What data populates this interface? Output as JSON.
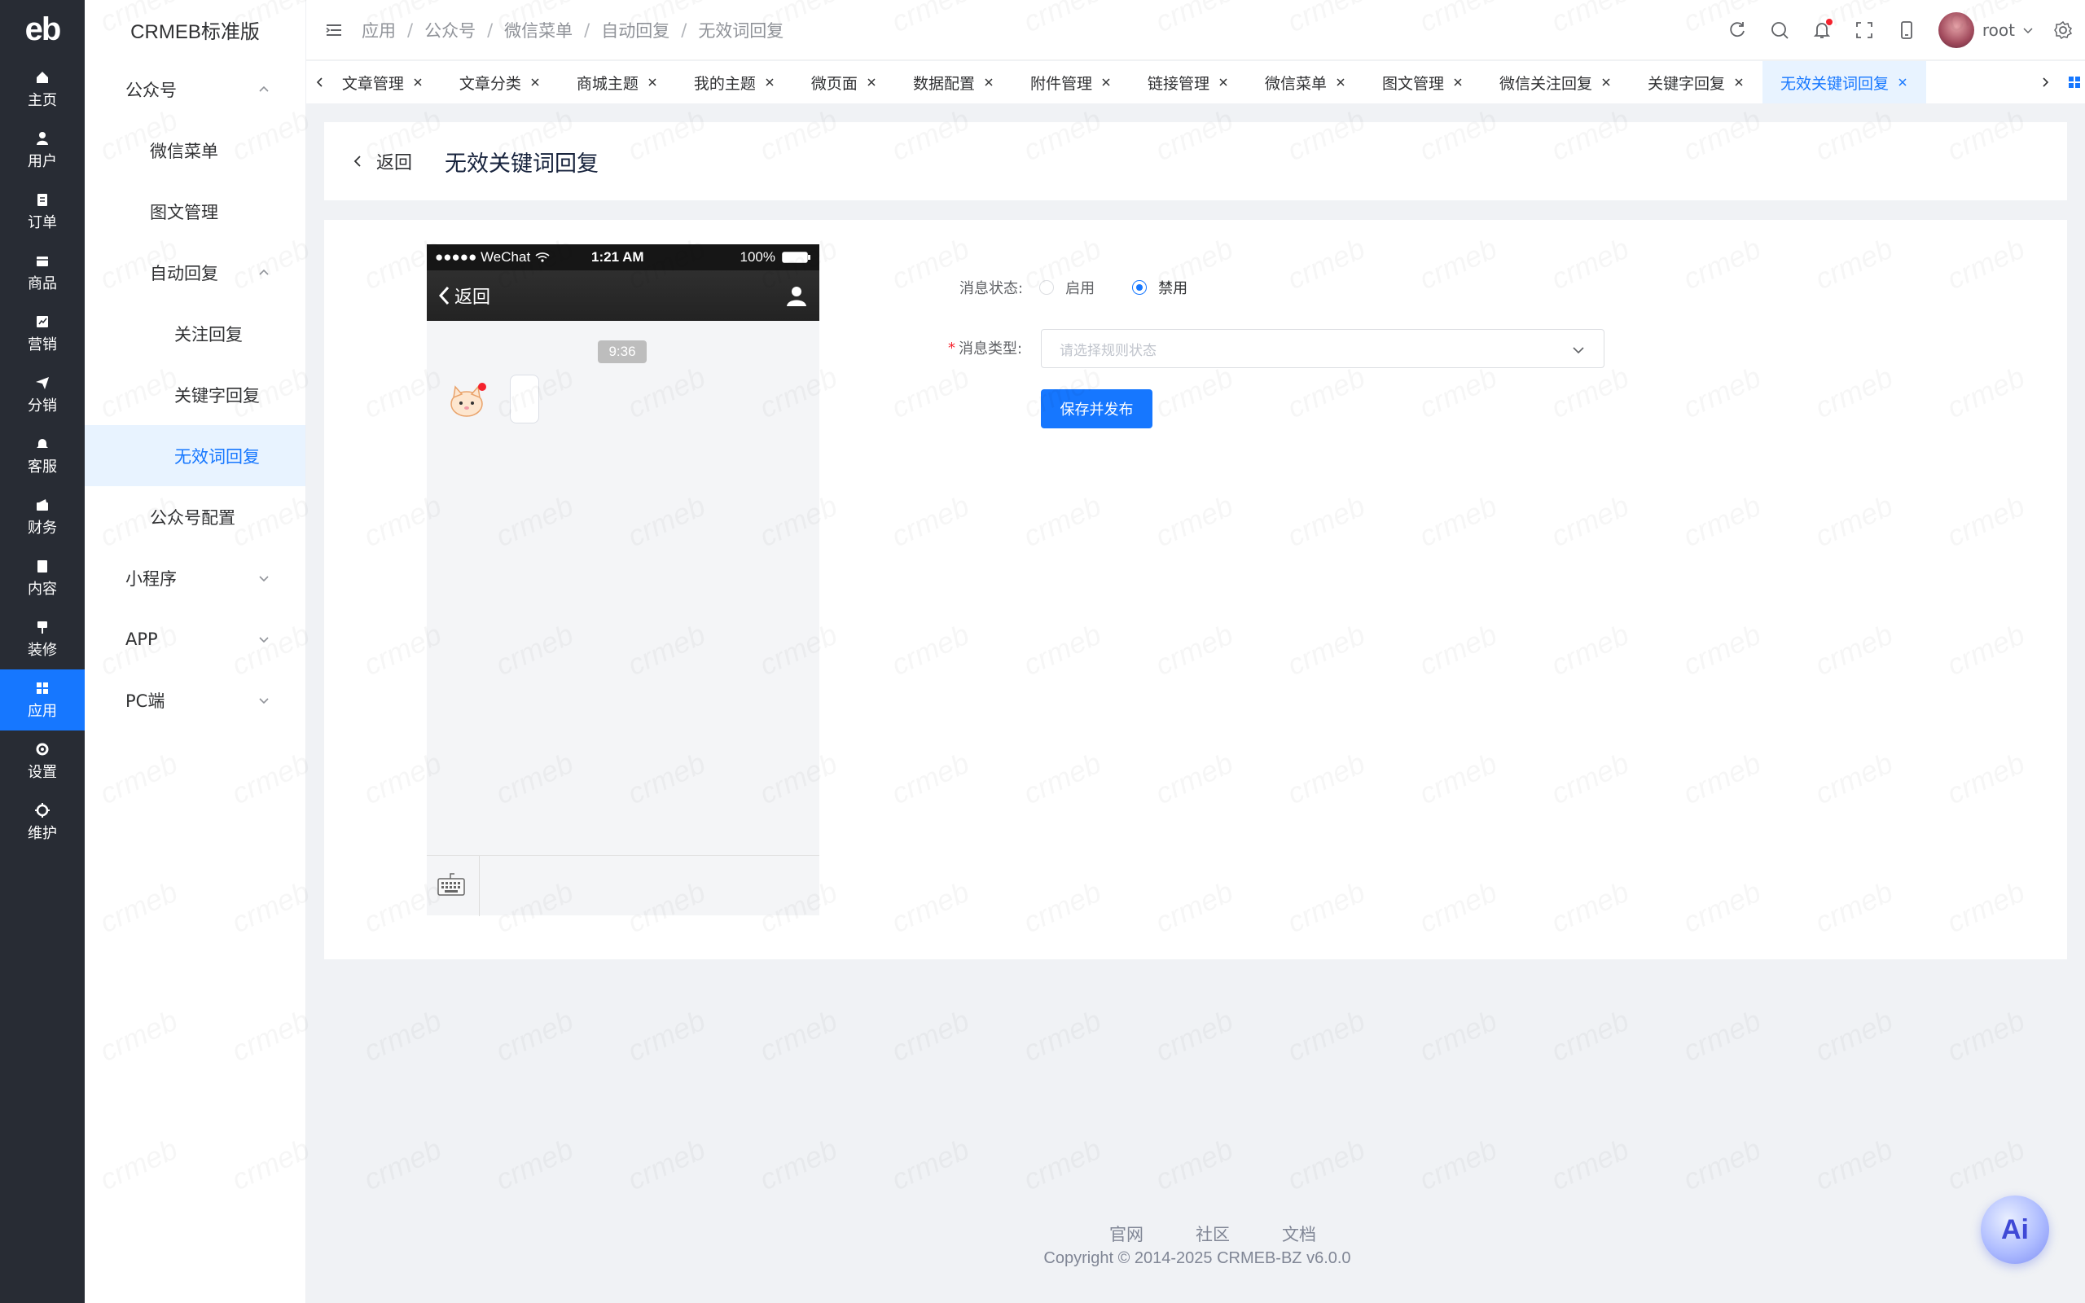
{
  "rail": {
    "logo": "eb",
    "items": [
      {
        "label": "主页",
        "icon": "home-icon"
      },
      {
        "label": "用户",
        "icon": "user-icon"
      },
      {
        "label": "订单",
        "icon": "order-icon"
      },
      {
        "label": "商品",
        "icon": "goods-icon"
      },
      {
        "label": "营销",
        "icon": "marketing-icon"
      },
      {
        "label": "分销",
        "icon": "distribution-icon"
      },
      {
        "label": "客服",
        "icon": "service-icon"
      },
      {
        "label": "财务",
        "icon": "finance-icon"
      },
      {
        "label": "内容",
        "icon": "content-icon"
      },
      {
        "label": "装修",
        "icon": "decorate-icon"
      },
      {
        "label": "应用",
        "icon": "app-icon",
        "active": true
      },
      {
        "label": "设置",
        "icon": "settings-icon"
      },
      {
        "label": "维护",
        "icon": "maintain-icon"
      }
    ]
  },
  "sidebar": {
    "title": "CRMEB标准版",
    "items": [
      {
        "label": "公众号"
      },
      {
        "label": "微信菜单"
      },
      {
        "label": "图文管理"
      },
      {
        "label": "自动回复"
      },
      {
        "label": "关注回复"
      },
      {
        "label": "关键字回复"
      },
      {
        "label": "无效词回复"
      },
      {
        "label": "公众号配置"
      },
      {
        "label": "小程序"
      },
      {
        "label": "APP"
      },
      {
        "label": "PC端"
      }
    ]
  },
  "breadcrumb": [
    "应用",
    "公众号",
    "微信菜单",
    "自动回复",
    "无效词回复"
  ],
  "breadcrumb_sep": "/",
  "header": {
    "username": "root"
  },
  "tabs": [
    {
      "label": "文章管理"
    },
    {
      "label": "文章分类"
    },
    {
      "label": "商城主题"
    },
    {
      "label": "我的主题"
    },
    {
      "label": "微页面"
    },
    {
      "label": "数据配置"
    },
    {
      "label": "附件管理"
    },
    {
      "label": "链接管理"
    },
    {
      "label": "微信菜单"
    },
    {
      "label": "图文管理"
    },
    {
      "label": "微信关注回复"
    },
    {
      "label": "关键字回复"
    },
    {
      "label": "无效关键词回复",
      "active": true
    }
  ],
  "page": {
    "back_label": "返回",
    "title": "无效关键词回复"
  },
  "phone": {
    "carrier": "●●●●● WeChat",
    "time": "1:21 AM",
    "battery": "100%",
    "back_label": "返回",
    "chat_time": "9:36"
  },
  "form": {
    "status_label": "消息状态:",
    "status_options": [
      "启用",
      "禁用"
    ],
    "status_selected": "禁用",
    "required_mark": "*",
    "type_label": "消息类型:",
    "type_placeholder": "请选择规则状态",
    "save_label": "保存并发布"
  },
  "footer": {
    "links": [
      "官网",
      "社区",
      "文档"
    ],
    "copyright": "Copyright © 2014-2025 CRMEB-BZ v6.0.0"
  },
  "ai_button": {
    "label": "Ai"
  },
  "watermark": {
    "text": "crmeb"
  },
  "colors": {
    "primary": "#1677ff",
    "rail": "#282c34",
    "active_bg": "#e8f3ff"
  }
}
